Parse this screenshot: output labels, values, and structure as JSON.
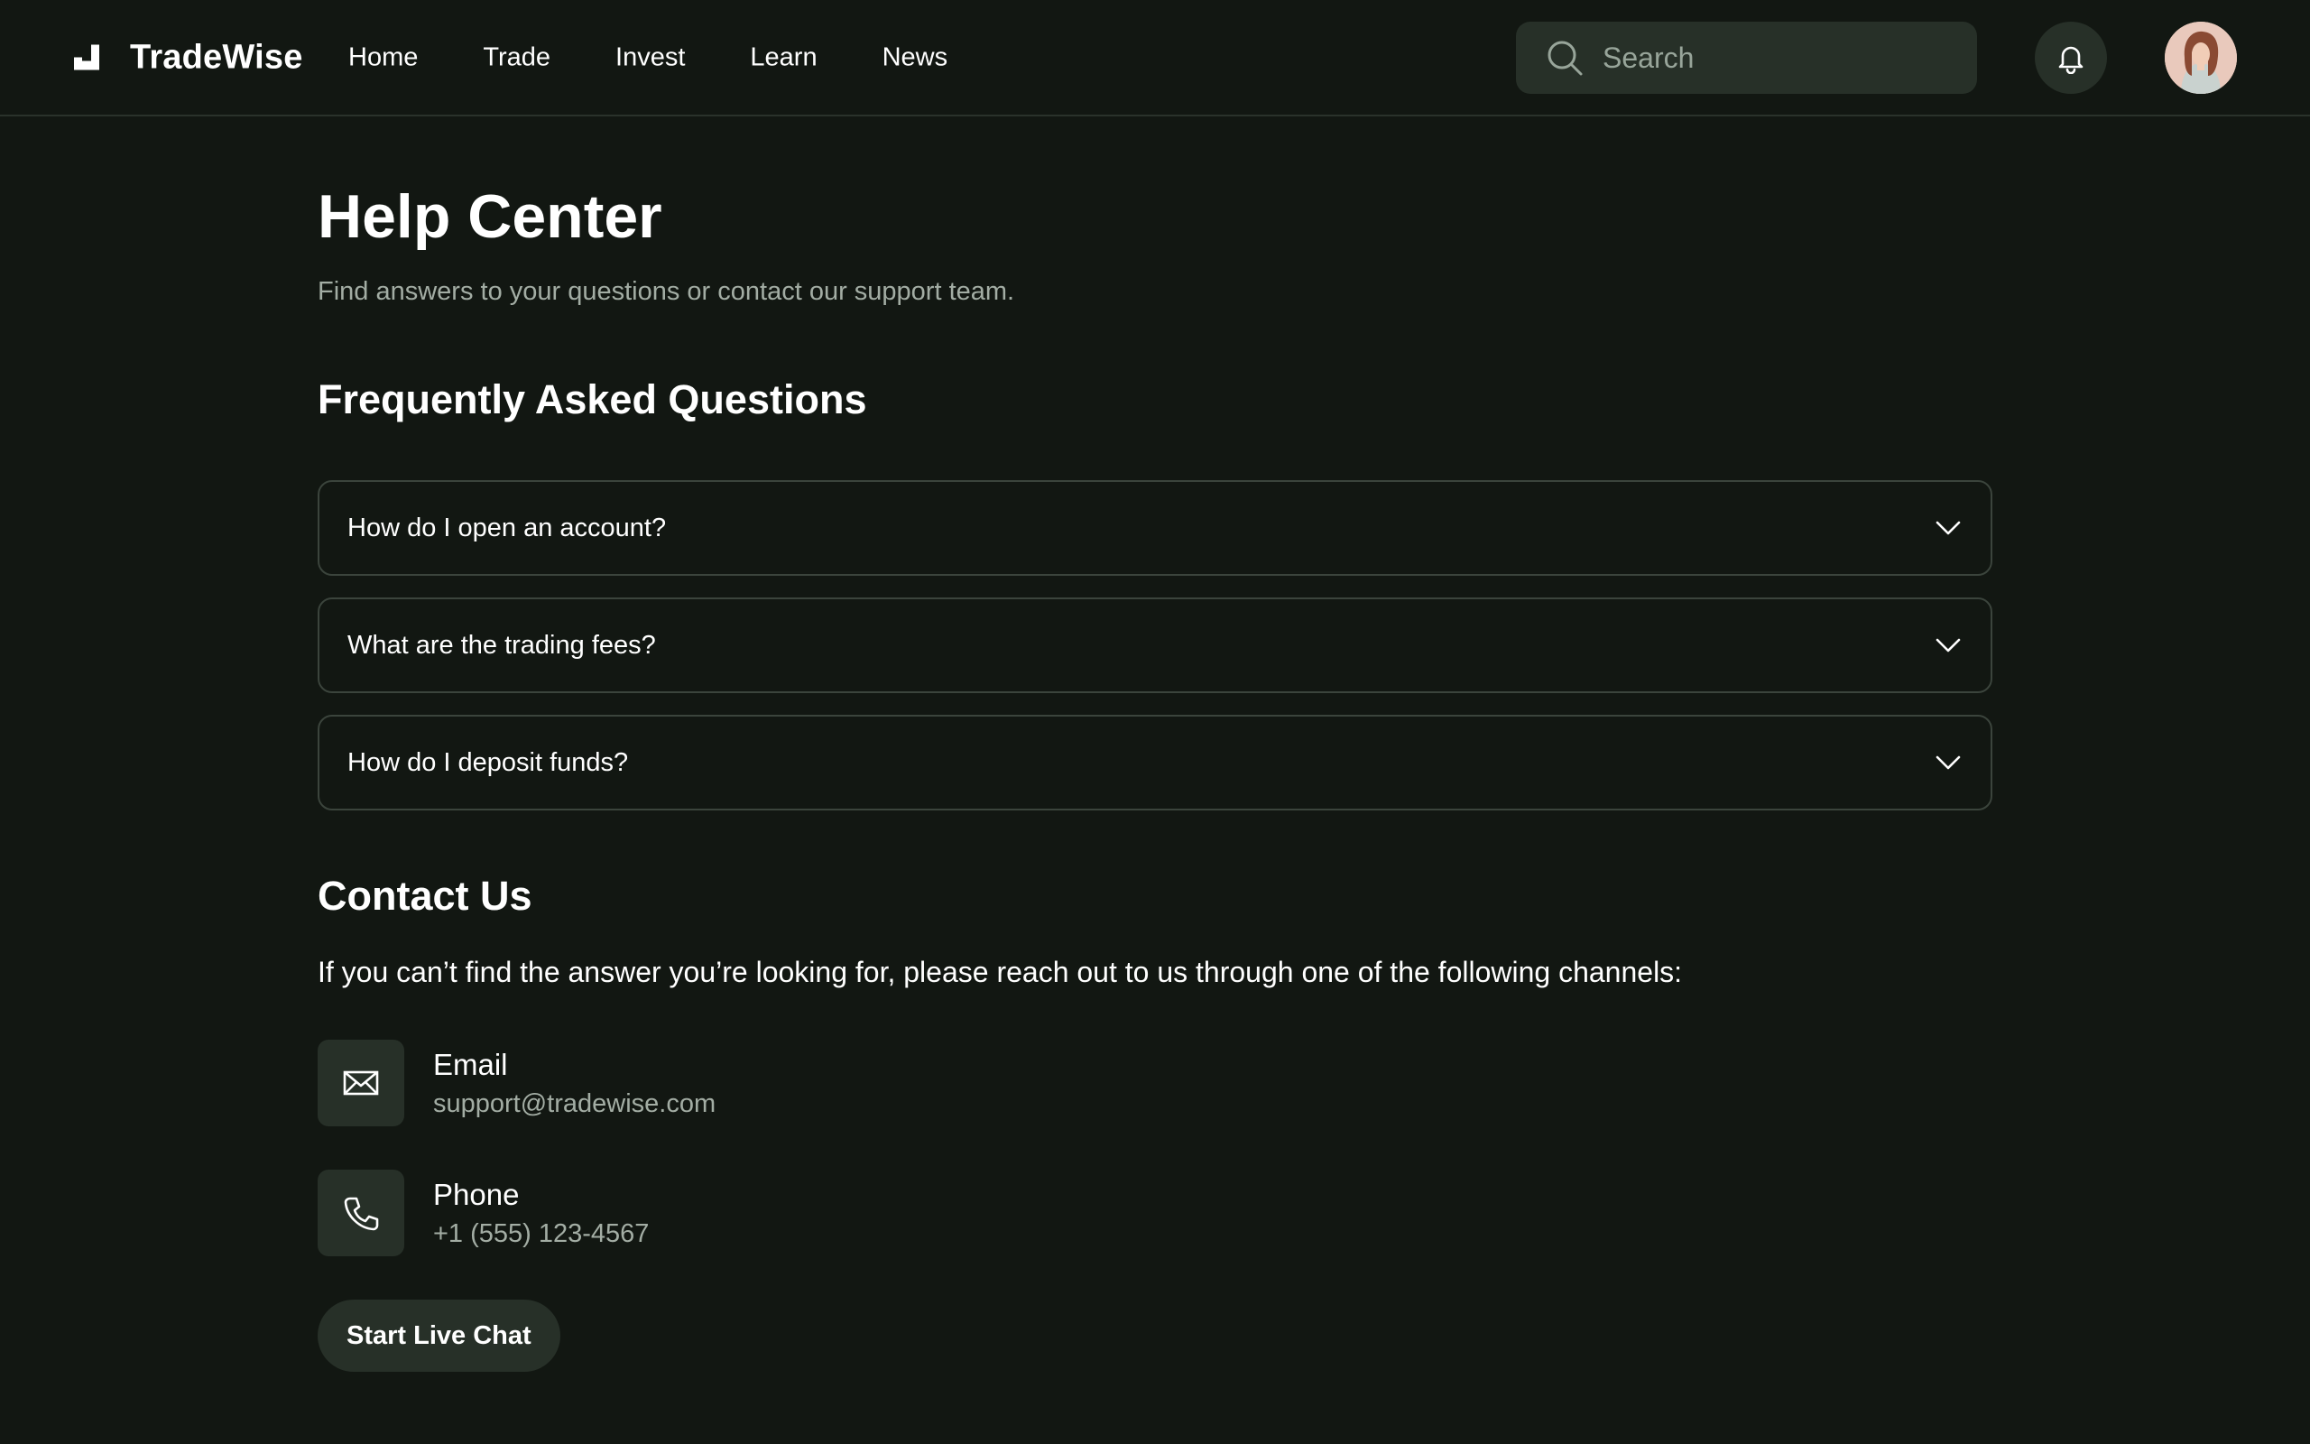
{
  "brand": {
    "name": "TradeWise"
  },
  "nav": [
    "Home",
    "Trade",
    "Invest",
    "Learn",
    "News"
  ],
  "search": {
    "placeholder": "Search",
    "value": ""
  },
  "page": {
    "title": "Help Center",
    "subtitle": "Find answers to your questions or contact our support team."
  },
  "faq": {
    "heading": "Frequently Asked Questions",
    "items": [
      "How do I open an account?",
      "What are the trading fees?",
      "How do I deposit funds?"
    ]
  },
  "contact": {
    "heading": "Contact Us",
    "description": "If you can’t find the answer you’re looking for, please reach out to us through one of the following channels:",
    "email": {
      "label": "Email",
      "value": "support@tradewise.com",
      "icon": "mail-icon"
    },
    "phone": {
      "label": "Phone",
      "value": "+1 (555) 123-4567",
      "icon": "phone-icon"
    },
    "chat_button": "Start Live Chat"
  },
  "colors": {
    "background": "#121712",
    "surface": "#273028",
    "border": "#3b443c",
    "muted_text": "#a3ada4"
  }
}
